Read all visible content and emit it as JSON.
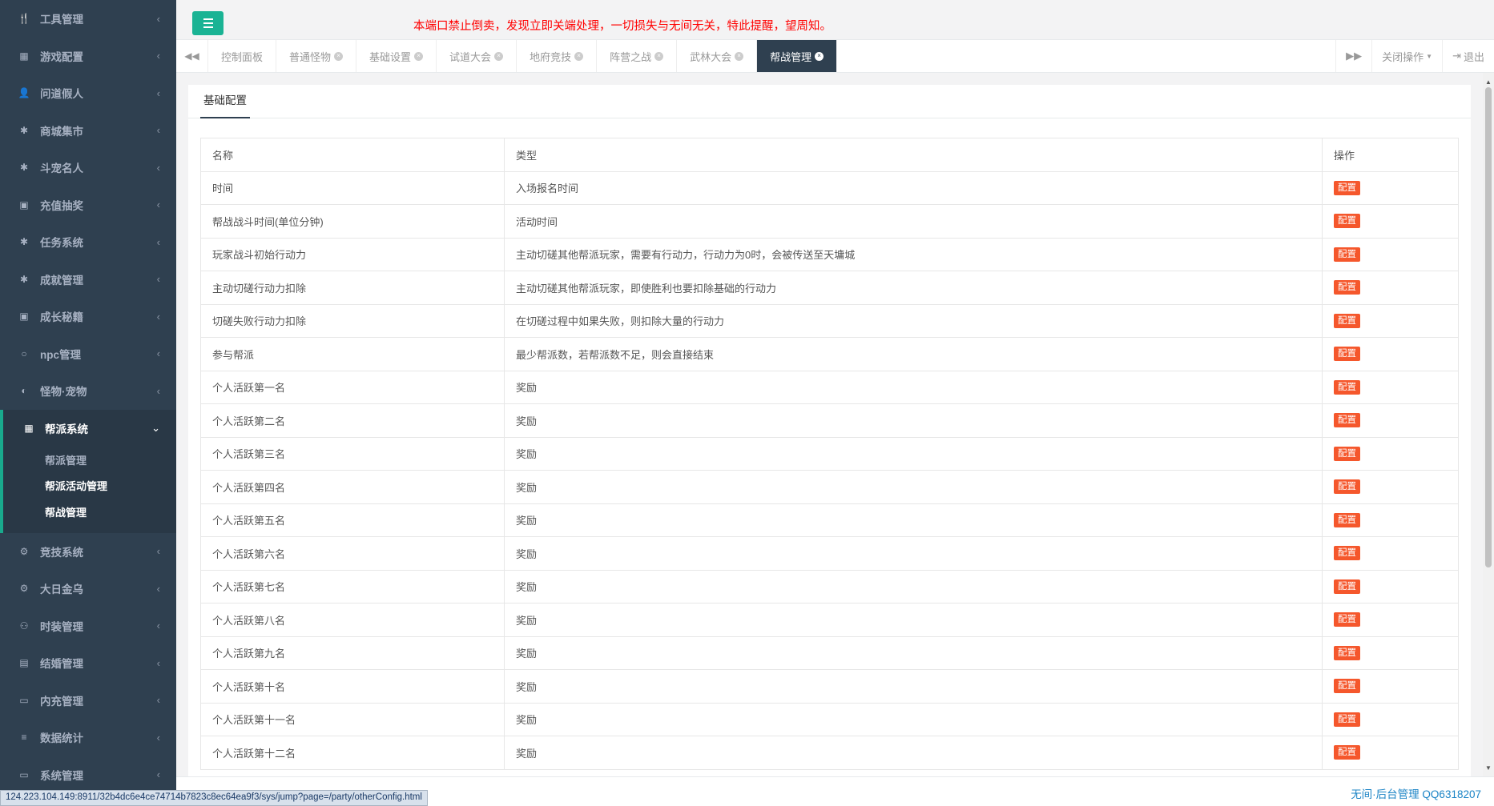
{
  "sidebar": {
    "items": [
      {
        "label": "工具管理",
        "icon": "tools-icon",
        "glyph": "🍴"
      },
      {
        "label": "游戏配置",
        "icon": "grid-icon",
        "glyph": "▦"
      },
      {
        "label": "问道假人",
        "icon": "user-icon",
        "glyph": "👤"
      },
      {
        "label": "商城集市",
        "icon": "gear-icon",
        "glyph": "✱"
      },
      {
        "label": "斗宠名人",
        "icon": "gear-icon",
        "glyph": "✱"
      },
      {
        "label": "充值抽奖",
        "icon": "money-icon",
        "glyph": "▣"
      },
      {
        "label": "任务系统",
        "icon": "gear-icon",
        "glyph": "✱"
      },
      {
        "label": "成就管理",
        "icon": "gear-icon",
        "glyph": "✱"
      },
      {
        "label": "成长秘籍",
        "icon": "money-icon",
        "glyph": "▣"
      },
      {
        "label": "npc管理",
        "icon": "circle-icon",
        "glyph": "○"
      },
      {
        "label": "怪物·宠物",
        "icon": "adjust-icon",
        "glyph": "◐"
      }
    ],
    "active_group": {
      "label": "帮派系统",
      "icon": "grid-icon",
      "glyph": "▦",
      "children": [
        "帮派管理",
        "帮派活动管理",
        "帮战管理"
      ]
    },
    "items_after": [
      {
        "label": "竞技系统",
        "icon": "cogs-icon",
        "glyph": "⚙"
      },
      {
        "label": "大日金乌",
        "icon": "cogs-icon",
        "glyph": "⚙"
      },
      {
        "label": "时装管理",
        "icon": "bike-icon",
        "glyph": "⚇"
      },
      {
        "label": "结婚管理",
        "icon": "vcard-icon",
        "glyph": "▤"
      },
      {
        "label": "内充管理",
        "icon": "monitor-icon",
        "glyph": "▭"
      },
      {
        "label": "数据统计",
        "icon": "database-icon",
        "glyph": "≡"
      },
      {
        "label": "系统管理",
        "icon": "window-icon",
        "glyph": "▭"
      }
    ],
    "chevron": "‹",
    "chevron_open": "⌄"
  },
  "topbar": {
    "notice": "本端口禁止倒卖，发现立即关端处理，一切损失与无间无关，特此提醒，望周知。"
  },
  "tabs": [
    {
      "label": "控制面板",
      "closable": false
    },
    {
      "label": "普通怪物",
      "closable": true
    },
    {
      "label": "基础设置",
      "closable": true
    },
    {
      "label": "试道大会",
      "closable": true
    },
    {
      "label": "地府竞技",
      "closable": true
    },
    {
      "label": "阵营之战",
      "closable": true
    },
    {
      "label": "武林大会",
      "closable": true
    },
    {
      "label": "帮战管理",
      "closable": true,
      "active": true
    }
  ],
  "tab_controls": {
    "close_ops": "关闭操作",
    "logout": "退出"
  },
  "panel": {
    "tab": "基础配置",
    "columns": [
      "名称",
      "类型",
      "操作"
    ],
    "action_label": "配置",
    "rows": [
      {
        "name": "时间",
        "type": "入场报名时间"
      },
      {
        "name": "帮战战斗时间(单位分钟)",
        "type": "活动时间"
      },
      {
        "name": "玩家战斗初始行动力",
        "type": "主动切磋其他帮派玩家，需要有行动力，行动力为0时，会被传送至天墉城"
      },
      {
        "name": "主动切磋行动力扣除",
        "type": "主动切磋其他帮派玩家，即使胜利也要扣除基础的行动力"
      },
      {
        "name": "切磋失败行动力扣除",
        "type": "在切磋过程中如果失败，则扣除大量的行动力"
      },
      {
        "name": "参与帮派",
        "type": "最少帮派数，若帮派数不足，则会直接结束"
      },
      {
        "name": "个人活跃第一名",
        "type": "奖励"
      },
      {
        "name": "个人活跃第二名",
        "type": "奖励"
      },
      {
        "name": "个人活跃第三名",
        "type": "奖励"
      },
      {
        "name": "个人活跃第四名",
        "type": "奖励"
      },
      {
        "name": "个人活跃第五名",
        "type": "奖励"
      },
      {
        "name": "个人活跃第六名",
        "type": "奖励"
      },
      {
        "name": "个人活跃第七名",
        "type": "奖励"
      },
      {
        "name": "个人活跃第八名",
        "type": "奖励"
      },
      {
        "name": "个人活跃第九名",
        "type": "奖励"
      },
      {
        "name": "个人活跃第十名",
        "type": "奖励"
      },
      {
        "name": "个人活跃第十一名",
        "type": "奖励"
      },
      {
        "name": "个人活跃第十二名",
        "type": "奖励"
      }
    ]
  },
  "footer": {
    "text": "无间·后台管理 QQ6318207",
    "status_url": "124.223.104.149:8911/32b4dc6e4ce74714b7823c8ec64ea9f3/sys/jump?page=/party/otherConfig.html"
  },
  "colors": {
    "sidebar_bg": "#2f4050",
    "accent": "#1ab394",
    "notice": "#ff0000",
    "config_button": "#f5572c",
    "footer_link": "#1c84c6"
  }
}
